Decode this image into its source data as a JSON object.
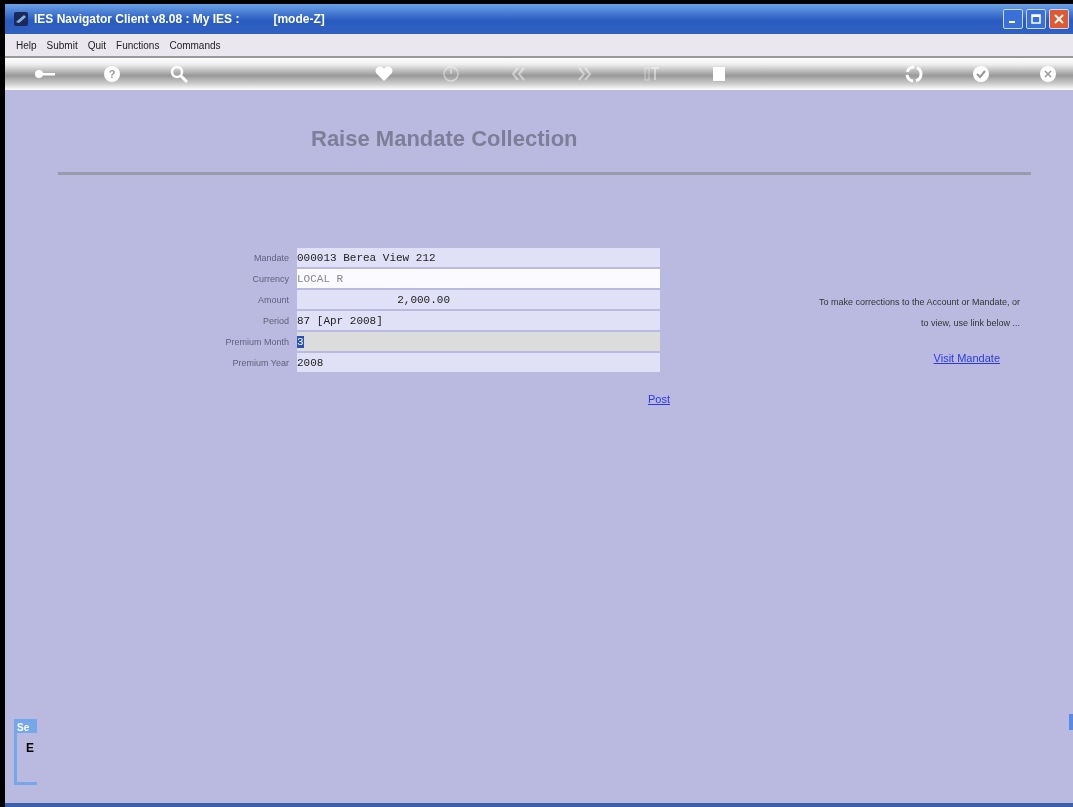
{
  "window": {
    "title": "IES Navigator Client v8.08 : My IES :",
    "mode": "[mode-Z]"
  },
  "menu": [
    "Help",
    "Submit",
    "Quit",
    "Functions",
    "Commands"
  ],
  "toolbar": [
    {
      "kind": "key",
      "disabled": false
    },
    {
      "kind": "help",
      "disabled": false,
      "label": "?"
    },
    {
      "kind": "search",
      "disabled": false
    },
    {
      "kind": "heart",
      "disabled": false
    },
    {
      "kind": "clock",
      "disabled": true
    },
    {
      "kind": "rewind",
      "disabled": true
    },
    {
      "kind": "forward",
      "disabled": true
    },
    {
      "kind": "text",
      "disabled": true
    },
    {
      "kind": "stop",
      "disabled": false
    },
    {
      "kind": "recycle",
      "disabled": false
    },
    {
      "kind": "check",
      "disabled": false
    },
    {
      "kind": "close",
      "disabled": false
    }
  ],
  "page_title": "Raise Mandate Collection",
  "fields": [
    {
      "label": "Mandate",
      "value": "000013 Berea View 212",
      "kind": "text",
      "readonly": false,
      "focused": false
    },
    {
      "label": "Currency",
      "value": "LOCAL R",
      "kind": "text",
      "readonly": true,
      "focused": false
    },
    {
      "label": "Amount",
      "value": "2,000.00",
      "kind": "number",
      "readonly": false,
      "focused": false
    },
    {
      "label": "Period",
      "value": "87  [Apr 2008]",
      "kind": "text",
      "readonly": false,
      "focused": false
    },
    {
      "label": "Premium Month",
      "value": "3",
      "kind": "text",
      "readonly": false,
      "focused": true
    },
    {
      "label": "Premium Year",
      "value": "2008",
      "kind": "text",
      "readonly": false,
      "focused": false
    }
  ],
  "post_link": "Post",
  "note": "To make corrections to the Account or Mandate, or to view, use link below ...",
  "visit_link": "Visit Mandate",
  "side_panel": {
    "tab": "Se",
    "text": "E"
  }
}
